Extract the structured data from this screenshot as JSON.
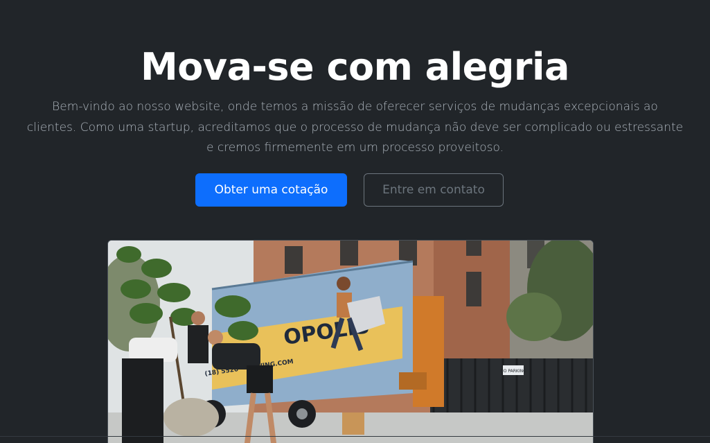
{
  "hero": {
    "title": "Mova-se com alegria",
    "lead_lines": [
      "Bem-vindo ao nosso website, onde temos a missão de oferecer serviços de mudanças excepcionais ao",
      "clientes. Como uma startup, acreditamos que o processo de mudança não deve ser complicado ou estressante",
      "e cremos firmemente em um processo proveitoso."
    ],
    "primary_button": "Obter uma cotação",
    "secondary_button": "Entre em contato"
  },
  "photo": {
    "truck_text": "OPOLIS",
    "truck_phone": "(18) 5520 • MOVING.COM",
    "gate_sign": "NO PARKING"
  },
  "colors": {
    "background": "#212529",
    "primary": "#0d6efd",
    "outline": "#6c757d",
    "title": "#ffffff",
    "lead": "#adb5bd"
  }
}
